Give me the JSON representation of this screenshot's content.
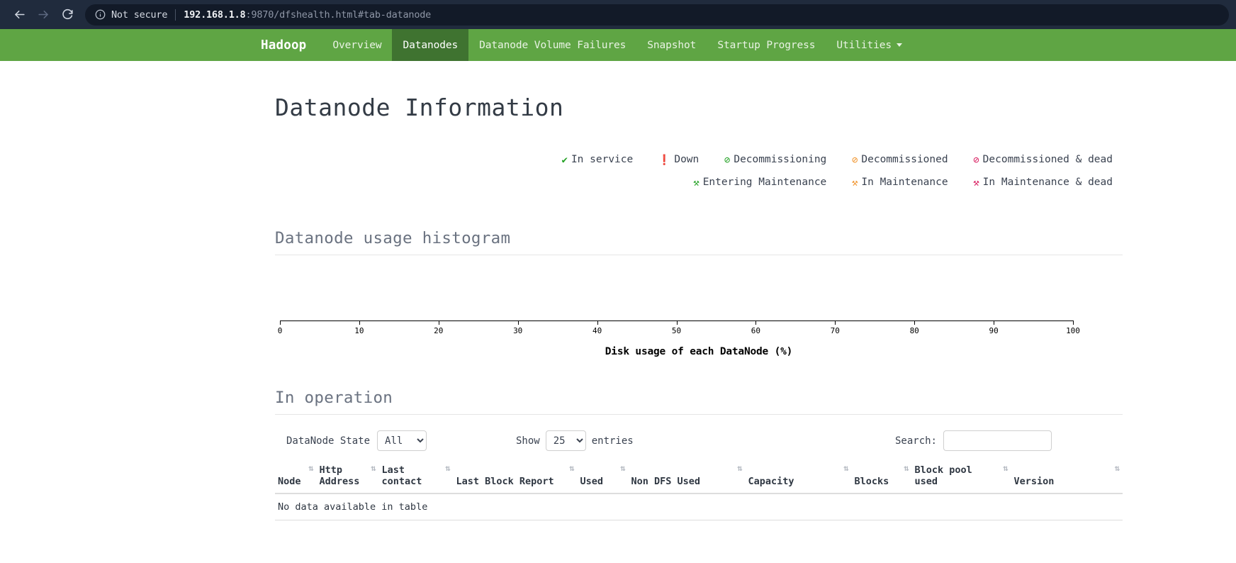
{
  "browser": {
    "back_icon": "back-arrow-icon",
    "forward_icon": "forward-arrow-icon",
    "reload_icon": "reload-icon",
    "info_icon": "info-circle-icon",
    "security_label": "Not secure",
    "url_host": "192.168.1.8",
    "url_rest": ":9870/dfshealth.html#tab-datanode",
    "url_full": "192.168.1.8:9870/dfshealth.html#tab-datanode"
  },
  "navbar": {
    "brand": "Hadoop",
    "accent_color": "#5fa544",
    "active_color": "#3f7330",
    "items": [
      {
        "label": "Overview",
        "active": false
      },
      {
        "label": "Datanodes",
        "active": true
      },
      {
        "label": "Datanode Volume Failures",
        "active": false
      },
      {
        "label": "Snapshot",
        "active": false
      },
      {
        "label": "Startup Progress",
        "active": false
      },
      {
        "label": "Utilities",
        "active": false,
        "dropdown": true
      }
    ]
  },
  "page": {
    "title": "Datanode Information"
  },
  "legend": {
    "rows": [
      [
        {
          "glyph": "✔",
          "color": "#23a124",
          "label": "In service",
          "icon": "check-icon"
        },
        {
          "glyph": "❗",
          "color": "#c9184a",
          "label": "Down",
          "icon": "exclamation-circle-icon"
        },
        {
          "glyph": "⊘",
          "color": "#23a124",
          "label": "Decommissioning",
          "icon": "ban-icon"
        },
        {
          "glyph": "⊘",
          "color": "#f0932b",
          "label": "Decommissioned",
          "icon": "ban-icon"
        },
        {
          "glyph": "⊘",
          "color": "#d81b5e",
          "label": "Decommissioned & dead",
          "icon": "ban-icon"
        }
      ],
      [
        {
          "glyph": "⚒",
          "color": "#23a124",
          "label": "Entering Maintenance",
          "icon": "wrench-icon"
        },
        {
          "glyph": "⚒",
          "color": "#f0932b",
          "label": "In Maintenance",
          "icon": "wrench-icon"
        },
        {
          "glyph": "⚒",
          "color": "#d81b5e",
          "label": "In Maintenance & dead",
          "icon": "wrench-icon"
        }
      ]
    ]
  },
  "histogram": {
    "title": "Datanode usage histogram",
    "axis_title": "Disk usage of each DataNode (%)"
  },
  "chart_data": {
    "type": "bar",
    "title": "Datanode usage histogram",
    "xlabel": "Disk usage of each DataNode (%)",
    "ylabel": "",
    "xlim": [
      0,
      100
    ],
    "ticks": [
      0,
      10,
      20,
      30,
      40,
      50,
      60,
      70,
      80,
      90,
      100
    ],
    "tick_labels": [
      "0",
      "10",
      "20",
      "30",
      "40",
      "50",
      "60",
      "70",
      "80",
      "90",
      "100"
    ],
    "categories": [],
    "values": [],
    "grid": false,
    "legend": "none",
    "note": "No bars rendered - histogram is empty (no datanodes)"
  },
  "in_operation": {
    "title": "In operation",
    "controls": {
      "datanode_state_label": "DataNode State",
      "datanode_state_value": "All",
      "datanode_state_options": [
        "All"
      ],
      "show_label": "Show",
      "entries_value": "25",
      "entries_options": [
        "25"
      ],
      "entries_label": "entries",
      "search_label": "Search:",
      "search_value": "",
      "search_placeholder": ""
    },
    "columns": [
      {
        "label": "Node",
        "sortable": true
      },
      {
        "label": "Http Address",
        "sortable": true
      },
      {
        "label": "Last contact",
        "sortable": true
      },
      {
        "label": "Last Block Report",
        "sortable": true
      },
      {
        "label": "Used",
        "sortable": true
      },
      {
        "label": "Non DFS Used",
        "sortable": true
      },
      {
        "label": "Capacity",
        "sortable": true
      },
      {
        "label": "Blocks",
        "sortable": true
      },
      {
        "label": "Block pool used",
        "sortable": true
      },
      {
        "label": "Version",
        "sortable": true
      }
    ],
    "rows": [],
    "empty_message": "No data available in table"
  }
}
